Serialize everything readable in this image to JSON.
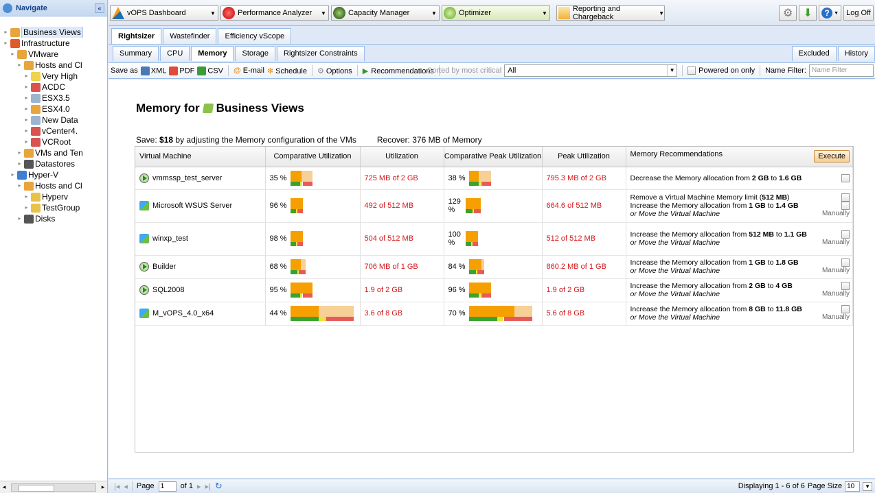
{
  "nav": {
    "title": "Navigate",
    "tree": [
      {
        "label": "Business Views",
        "level": 0,
        "selected": true,
        "color": "#e8a53c"
      },
      {
        "label": "Infrastructure",
        "level": 0,
        "color": "#e05a2b"
      },
      {
        "label": "VMware",
        "level": 1,
        "color": "#e8a53c"
      },
      {
        "label": "Hosts and Cl",
        "level": 2,
        "color": "#e8a53c"
      },
      {
        "label": "Very High",
        "level": 3,
        "color": "#f2d14c"
      },
      {
        "label": "ACDC",
        "level": 3,
        "color": "#d9534f"
      },
      {
        "label": "ESX3.5",
        "level": 3,
        "color": "#9db4cf"
      },
      {
        "label": "ESX4.0",
        "level": 3,
        "color": "#e8a53c"
      },
      {
        "label": "New Data",
        "level": 3,
        "color": "#9db4cf"
      },
      {
        "label": "vCenter4.",
        "level": 3,
        "color": "#d9534f"
      },
      {
        "label": "VCRoot",
        "level": 3,
        "color": "#d9534f"
      },
      {
        "label": "VMs and Ten",
        "level": 2,
        "color": "#e8a53c"
      },
      {
        "label": "Datastores",
        "level": 2,
        "color": "#555555"
      },
      {
        "label": "Hyper-V",
        "level": 1,
        "color": "#3d7fd1"
      },
      {
        "label": "Hosts and Cl",
        "level": 2,
        "color": "#e8a53c"
      },
      {
        "label": "Hyperv",
        "level": 3,
        "color": "#e8c34c"
      },
      {
        "label": "TestGroup",
        "level": 3,
        "color": "#e8c34c"
      },
      {
        "label": "Disks",
        "level": 2,
        "color": "#555555"
      }
    ],
    "scroll_label": "III"
  },
  "toolbar": {
    "dashboard": "vOPS Dashboard",
    "performance": "Performance Analyzer",
    "capacity": "Capacity Manager",
    "optimizer": "Optimizer",
    "reporting": "Reporting and Chargeback",
    "logoff": "Log Off"
  },
  "tabs1": [
    "Rightsizer",
    "Wastefinder",
    "Efficiency vScope"
  ],
  "tabs2": [
    "Summary",
    "CPU",
    "Memory",
    "Storage",
    "Rightsizer Constraints"
  ],
  "tabs2_right": [
    "Excluded",
    "History"
  ],
  "actions": {
    "save_as": "Save as",
    "xml": "XML",
    "pdf": "PDF",
    "csv": "CSV",
    "email": "E-mail",
    "schedule": "Schedule",
    "options": "Options",
    "recommendations": "Recommendations",
    "sorted": "Sorted by most critical",
    "filter_value": "All",
    "powered_on": "Powered on only",
    "name_filter": "Name Filter:",
    "name_filter_placeholder": "Name Filter"
  },
  "main": {
    "title_prefix": "Memory for",
    "title_entity": "Business Views",
    "save_text": "Save: ",
    "save_amount": "$18",
    "save_suffix": " by adjusting the Memory configuration of the VMs",
    "recover": "Recover: 376 MB of Memory"
  },
  "grid": {
    "headers": [
      "Virtual Machine",
      "Comparative Utilization",
      "Utilization",
      "Comparative Peak Utilization",
      "Peak Utilization",
      "Memory Recommendations"
    ],
    "execute": "Execute",
    "rows": [
      {
        "name": "vmmssp_test_server",
        "icon": "play",
        "cu": "35 %",
        "cu_w": 32,
        "cu_fill": 0.5,
        "util": "725 MB of 2 GB",
        "cpu": "38 %",
        "cpu_w": 32,
        "cpu_fill": 0.45,
        "peak": "795.3 MB of 2 GB",
        "rec": [
          {
            "t": "Decrease the Memory allocation from <b>2 GB</b> to <b>1.6 GB</b>",
            "ctl": "chk"
          }
        ]
      },
      {
        "name": "Microsoft WSUS Server",
        "icon": "ms",
        "cu": "96 %",
        "cu_w": 18,
        "cu_fill": 1,
        "util": "492 of 512 MB",
        "cpu": "129 %",
        "cpu_w": 22,
        "cpu_fill": 1,
        "peak": "664.6 of 512 MB",
        "rec": [
          {
            "t": "Remove a Virtual Machine Memory limit (<b>512 MB</b>)",
            "ctl": "chk"
          },
          {
            "t": "Increase the Memory allocation from <b>1 GB</b> to <b>1.4 GB</b>",
            "ctl": "chk"
          },
          {
            "t": "<i>or Move the Virtual Machine</i>",
            "ctl": "manual"
          }
        ]
      },
      {
        "name": "winxp_test",
        "icon": "ms",
        "cu": "98 %",
        "cu_w": 18,
        "cu_fill": 1,
        "util": "504 of 512 MB",
        "cpu": "100 %",
        "cpu_w": 18,
        "cpu_fill": 1,
        "peak": "512 of 512 MB",
        "rec": [
          {
            "t": "Increase the Memory allocation from <b>512 MB</b> to <b>1.1 GB</b>",
            "ctl": "chk"
          },
          {
            "t": "<i>or Move the Virtual Machine</i>",
            "ctl": "manual"
          }
        ]
      },
      {
        "name": "Builder",
        "icon": "play",
        "cu": "68 %",
        "cu_w": 22,
        "cu_fill": 0.7,
        "util": "706 MB of 1 GB",
        "cpu": "84 %",
        "cpu_w": 22,
        "cpu_fill": 0.8,
        "peak": "860.2 MB of 1 GB",
        "rec": [
          {
            "t": "Increase the Memory allocation from <b>1 GB</b> to <b>1.8 GB</b>",
            "ctl": "chk"
          },
          {
            "t": "<i>or Move the Virtual Machine</i>",
            "ctl": "manual"
          }
        ]
      },
      {
        "name": "SQL2008",
        "icon": "play",
        "cu": "95 %",
        "cu_w": 32,
        "cu_fill": 1,
        "util": "1.9 of 2 GB",
        "cpu": "96 %",
        "cpu_w": 32,
        "cpu_fill": 1,
        "peak": "1.9 of 2 GB",
        "rec": [
          {
            "t": "Increase the Memory allocation from <b>2 GB</b> to <b>4 GB</b>",
            "ctl": "chk"
          },
          {
            "t": "<i>or Move the Virtual Machine</i>",
            "ctl": "manual"
          }
        ]
      },
      {
        "name": "M_vOPS_4.0_x64",
        "icon": "ms",
        "cu": "44 %",
        "cu_w": 92,
        "cu_fill": 0.45,
        "util": "3.6 of 8 GB",
        "cpu": "70 %",
        "cpu_w": 92,
        "cpu_fill": 0.72,
        "peak": "5.6 of 8 GB",
        "rec": [
          {
            "t": "Increase the Memory allocation from <b>8 GB</b> to <b>11.8 GB</b>",
            "ctl": "chk"
          },
          {
            "t": "<i>or Move the Virtual Machine</i>",
            "ctl": "manual"
          }
        ]
      }
    ],
    "manually": "Manually"
  },
  "paging": {
    "page_label": "Page",
    "page_value": "1",
    "of": "of 1",
    "display": "Displaying 1 - 6 of 6",
    "page_size_label": "Page Size",
    "page_size": "10"
  }
}
